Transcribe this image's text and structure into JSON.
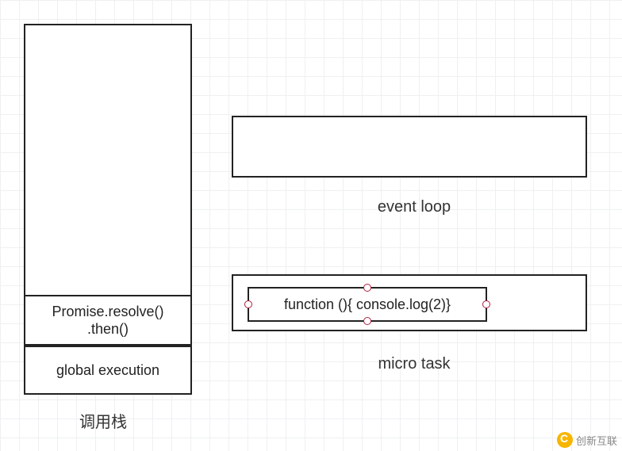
{
  "call_stack": {
    "label": "调用栈",
    "frames": [
      "global execution",
      "Promise.resolve()\n.then()"
    ]
  },
  "event_loop": {
    "label": "event loop"
  },
  "micro_task": {
    "label": "micro task",
    "items": [
      "function (){ console.log(2)}"
    ]
  },
  "watermark": "创新互联"
}
